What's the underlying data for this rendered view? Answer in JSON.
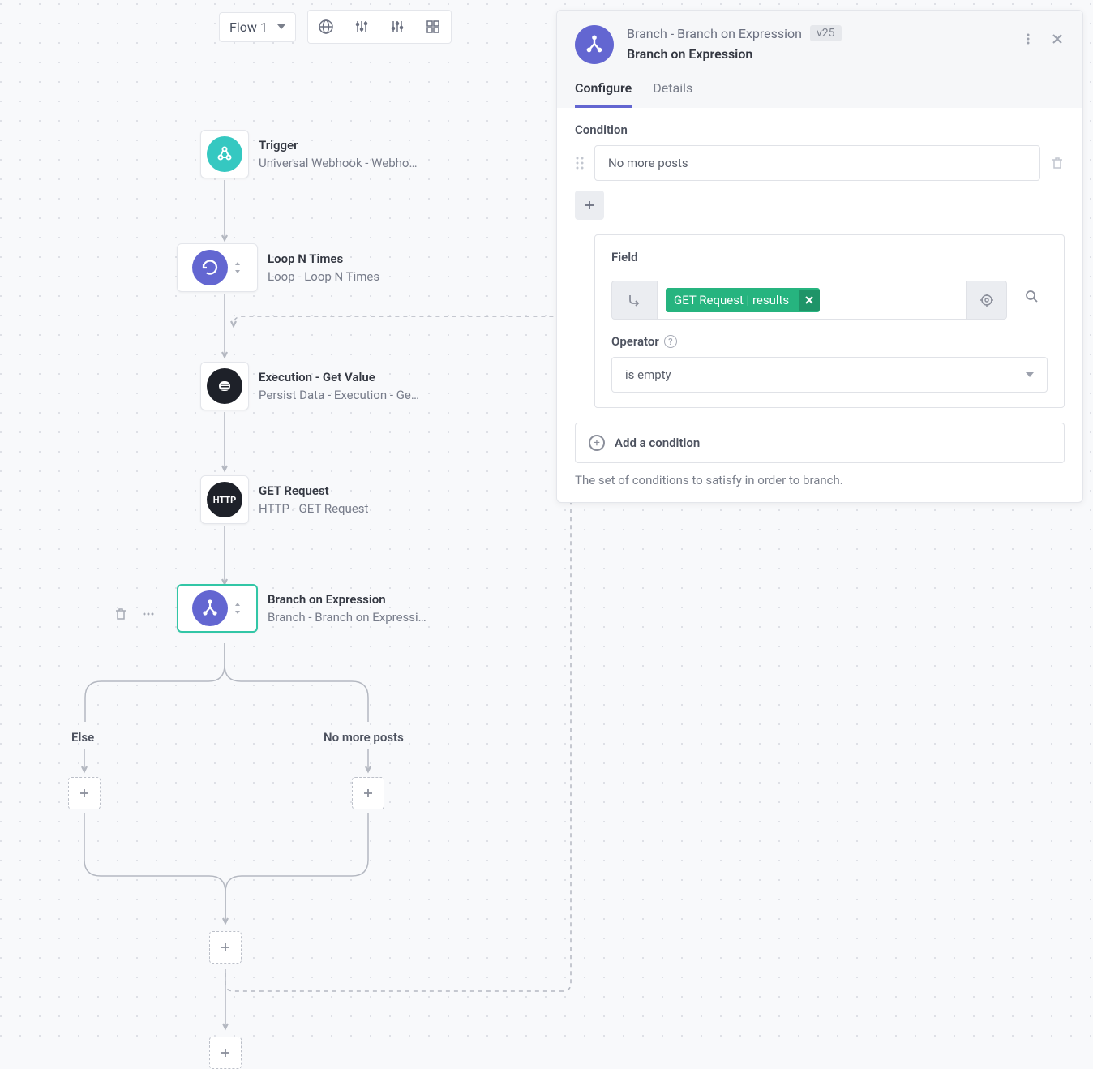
{
  "toolbar": {
    "flow_label": "Flow 1"
  },
  "nodes": {
    "trigger": {
      "title": "Trigger",
      "sub": "Universal Webhook - Webhook"
    },
    "loop": {
      "title": "Loop N Times",
      "sub": "Loop - Loop N Times"
    },
    "exec": {
      "title": "Execution - Get Value",
      "sub": "Persist Data - Execution - Get …"
    },
    "get": {
      "title": "GET Request",
      "sub": "HTTP - GET Request"
    },
    "branch": {
      "title": "Branch on Expression",
      "sub": "Branch - Branch on Expression"
    }
  },
  "branches": {
    "else_label": "Else",
    "nomore_label": "No more posts"
  },
  "panel": {
    "crumb": "Branch - Branch on Expression",
    "version": "v25",
    "title": "Branch on Expression",
    "tabs": {
      "configure": "Configure",
      "details": "Details"
    },
    "condition_label": "Condition",
    "condition_value": "No more posts",
    "field_label": "Field",
    "chip_value": "GET Request | results",
    "operator_label": "Operator",
    "operator_value": "is empty",
    "add_condition": "Add a condition",
    "help_text": "The set of conditions to satisfy in order to branch."
  }
}
